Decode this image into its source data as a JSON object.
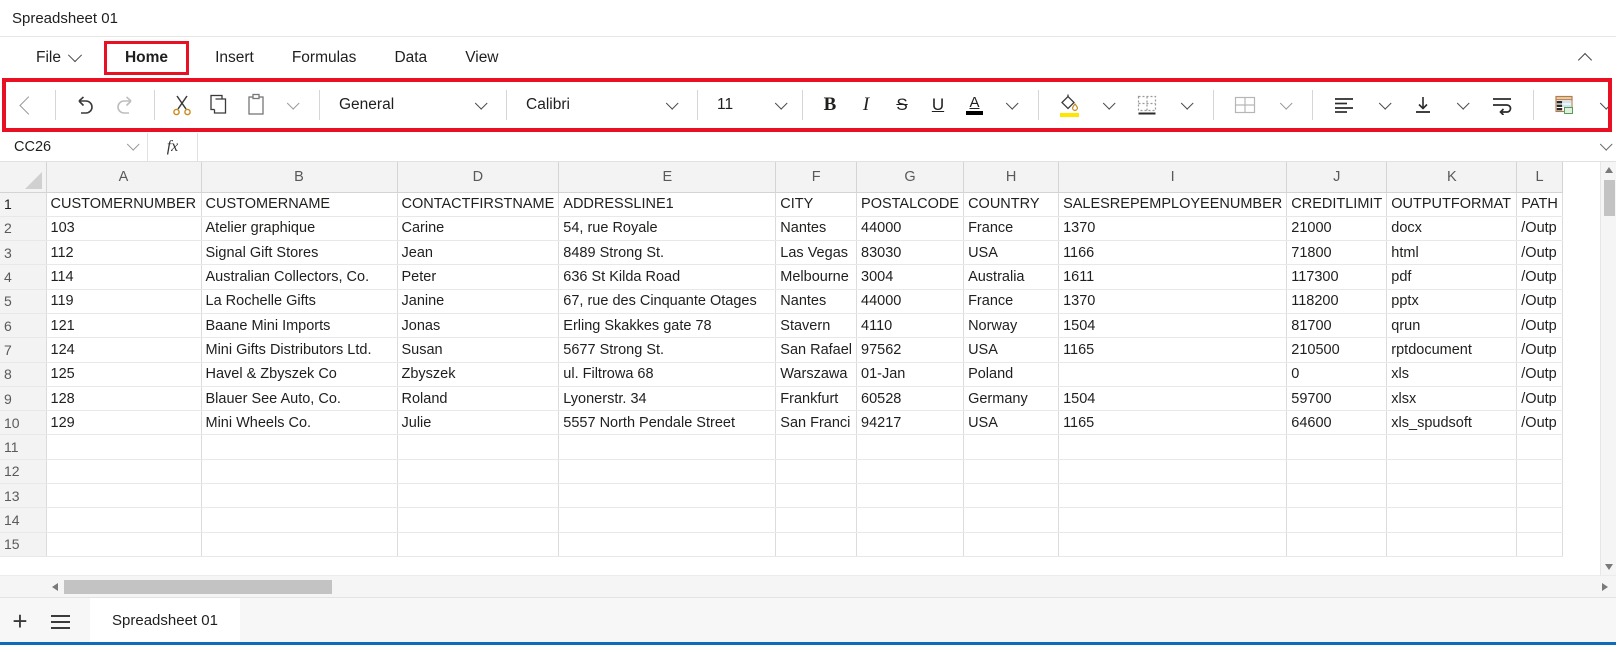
{
  "window": {
    "title": "Spreadsheet 01"
  },
  "menu": {
    "items": [
      {
        "label": "File",
        "icon": "chevron-down-icon",
        "has_caret": true,
        "active": false
      },
      {
        "label": "Home",
        "has_caret": false,
        "active": true
      },
      {
        "label": "Insert",
        "has_caret": false,
        "active": false
      },
      {
        "label": "Formulas",
        "has_caret": false,
        "active": false
      },
      {
        "label": "Data",
        "has_caret": false,
        "active": false
      },
      {
        "label": "View",
        "has_caret": false,
        "active": false
      }
    ],
    "collapse_icon": "chevron-up-icon",
    "highlight_color": "#e81123"
  },
  "toolbar": {
    "outline_color": "#e81123",
    "scroll_left_icon": "chevron-left-icon",
    "scroll_right_icon": "chevron-right-icon",
    "undo_icon": "undo-arrow-icon",
    "redo_icon": "redo-arrow-icon",
    "cut_icon": "scissors-icon",
    "copy_icon": "copy-pages-icon",
    "paste_icon": "clipboard-icon",
    "paste_caret_icon": "chevron-down-icon",
    "number_format": "General",
    "font_name": "Calibri",
    "font_size": "11",
    "bold_label": "B",
    "italic_label": "I",
    "strikethrough_label": "S",
    "underline_label": "U",
    "font_color_label": "A",
    "font_color_swatch": "#000000",
    "fill_color_icon": "paint-bucket-icon",
    "fill_color_swatch": "#ffe600",
    "borders_icon": "borders-icon",
    "merge_cells_icon": "merge-cells-icon",
    "align_icon": "align-left-icon",
    "vertical_align_icon": "align-bottom-icon",
    "wrap_text_icon": "wrap-text-icon",
    "table_format_icon": "format-as-table-icon"
  },
  "formula_bar": {
    "cell_reference": "CC26",
    "namebox_caret_icon": "chevron-down-icon",
    "fx_label": "fx",
    "formula_value": "",
    "expand_caret_icon": "chevron-down-icon"
  },
  "grid": {
    "column_headers": [
      "A",
      "B",
      "D",
      "E",
      "F",
      "G",
      "H",
      "I",
      "J",
      "K",
      "L"
    ],
    "row_numbers": [
      "1",
      "2",
      "3",
      "4",
      "5",
      "6",
      "7",
      "8",
      "9",
      "10",
      "11",
      "12",
      "13",
      "14",
      "15"
    ],
    "header_row": [
      "CUSTOMERNUMBER",
      "CUSTOMERNAME",
      "CONTACTFIRSTNAME",
      "ADDRESSLINE1",
      "CITY",
      "POSTALCODE",
      "COUNTRY",
      "SALESREPEMPLOYEENUMBER",
      "CREDITLIMIT",
      "OUTPUTFORMAT",
      "PATH"
    ],
    "rows": [
      [
        "103",
        "Atelier graphique",
        "Carine",
        "54, rue Royale",
        "Nantes",
        "44000",
        "France",
        "1370",
        "21000",
        "docx",
        "/Outp"
      ],
      [
        "112",
        "Signal Gift Stores",
        "Jean",
        "8489 Strong St.",
        "Las Vegas",
        "83030",
        "USA",
        "1166",
        "71800",
        "html",
        "/Outp"
      ],
      [
        "114",
        "Australian Collectors, Co.",
        "Peter",
        "636 St Kilda Road",
        "Melbourne",
        "3004",
        "Australia",
        "1611",
        "117300",
        "pdf",
        "/Outp"
      ],
      [
        "119",
        "La Rochelle Gifts",
        "Janine",
        "67, rue des Cinquante Otages",
        "Nantes",
        "44000",
        "France",
        "1370",
        "118200",
        "pptx",
        "/Outp"
      ],
      [
        "121",
        "Baane Mini Imports",
        "Jonas",
        "Erling Skakkes gate 78",
        "Stavern",
        "4110",
        "Norway",
        "1504",
        "81700",
        "qrun",
        "/Outp"
      ],
      [
        "124",
        "Mini Gifts Distributors Ltd.",
        "Susan",
        "5677 Strong St.",
        "San Rafael",
        "97562",
        "USA",
        "1165",
        "210500",
        "rptdocument",
        "/Outp"
      ],
      [
        "125",
        "Havel & Zbyszek Co",
        "Zbyszek",
        "ul. Filtrowa 68",
        "Warszawa",
        "01-Jan",
        "Poland",
        "",
        "0",
        "xls",
        "/Outp"
      ],
      [
        "128",
        "Blauer See Auto, Co.",
        "Roland",
        "Lyonerstr. 34",
        "Frankfurt",
        "60528",
        "Germany",
        "1504",
        "59700",
        "xlsx",
        "/Outp"
      ],
      [
        "129",
        "Mini Wheels Co.",
        "Julie",
        "5557 North Pendale Street",
        "San Franci",
        "94217",
        "USA",
        "1165",
        "64600",
        "xls_spudsoft",
        "/Outp"
      ]
    ],
    "blank_row_count": 5,
    "numeric_columns": [
      0,
      5,
      7,
      8
    ],
    "vscroll_up_icon": "scroll-up-arrow-icon",
    "vscroll_down_icon": "scroll-down-arrow-icon",
    "hscroll_left_icon": "scroll-left-arrow-icon",
    "hscroll_right_icon": "scroll-right-arrow-icon"
  },
  "sheet_bar": {
    "add_sheet_label": "+",
    "sheet_list_icon": "hamburger-menu-icon",
    "tabs": [
      {
        "label": "Spreadsheet 01",
        "active": true
      }
    ],
    "active_color": "#0078d4"
  }
}
